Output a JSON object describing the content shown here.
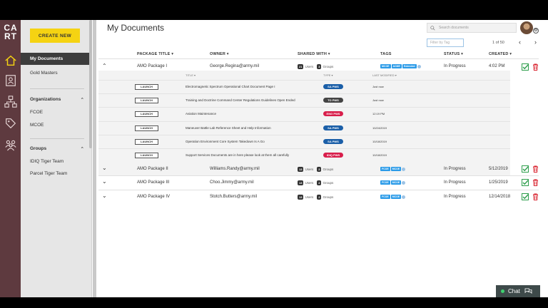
{
  "app": {
    "logo_line1": "CA",
    "logo_line2": "RT"
  },
  "sidebar": {
    "create_label": "CREATE NEW",
    "my_documents": "My Documents",
    "gold_masters": "Gold Masters",
    "organizations_header": "Organizations",
    "organizations": [
      "FCOE",
      "MCOE"
    ],
    "groups_header": "Groups",
    "groups": [
      "IDIQ Tiger Team",
      "Parcel Tiger Team"
    ]
  },
  "main": {
    "title": "My Documents",
    "search_placeholder": "Search documents",
    "filter_placeholder": "Filter by Tag",
    "pager": "1 of 50",
    "columns": {
      "package": "PACKAGE TITLE ▾",
      "owner": "OWNER ▾",
      "shared": "SHARED WITH ▾",
      "tags": "TAGS",
      "status": "STATUS ▾",
      "created": "CREATED ▾"
    },
    "sub_columns": {
      "title": "TITLE ▾",
      "type": "TYPE ▾",
      "modified": "LAST MODIFIED ▾"
    },
    "users_label": "Users",
    "groups_label": "Groups",
    "rows": [
      {
        "title": "AMO Package I",
        "owner": "George.Regina@army.mil",
        "users": "21",
        "groups": "3",
        "tags": [
          "MCOE",
          "ACME",
          "Extended"
        ],
        "status": "In Progress",
        "created": "4:02 PM",
        "docs": [
          {
            "launch": "LAUNCH",
            "title": "Electromagnetic Spectrum Operational Chart Document Page I",
            "type": "SA PWS",
            "type_color": "#1b5fa8",
            "modified": "Just now"
          },
          {
            "launch": "LAUNCH",
            "title": "Training and Doctrine Command Center Regulations Guidelines Open Ended",
            "type": "TO PWS",
            "type_color": "#444444",
            "modified": "Just now"
          },
          {
            "launch": "LAUNCH",
            "title": "Aviation Maintenance",
            "type": "ENG PWS",
            "type_color": "#d81e4b",
            "modified": "12:19 PM"
          },
          {
            "launch": "LAUNCH",
            "title": "Maneuver Battle Lab Reference Sheet and Help Information",
            "type": "SA PWS",
            "type_color": "#1b5fa8",
            "modified": "10/24/2019"
          },
          {
            "launch": "LAUNCH",
            "title": "Operation Environment Core System Takedown Is A Go",
            "type": "SA PWS",
            "type_color": "#1b5fa8",
            "modified": "10/18/2019"
          },
          {
            "launch": "LAUNCH",
            "title": "Support Services Documents are in here please look at them all carefully",
            "type": "IDIQ PWS",
            "type_color": "#d81e4b",
            "modified": "10/18/2019"
          }
        ]
      },
      {
        "title": "AMO Package II",
        "owner": "Williams.Randy@army.mil",
        "users": "13",
        "groups": "2",
        "tags": [
          "FCOE",
          "MCOE"
        ],
        "status": "In Progress",
        "created": "5/12/2019"
      },
      {
        "title": "AMO Package III",
        "owner": "Choo.Jimmy@army.mil",
        "users": "13",
        "groups": "2",
        "tags": [
          "FCOE",
          "MCOE"
        ],
        "status": "In Progress",
        "created": "1/25/2019"
      },
      {
        "title": "AMO Package IV",
        "owner": "Stotch.Butters@army.mil",
        "users": "13",
        "groups": "2",
        "tags": [
          "FCOE",
          "MCOE"
        ],
        "status": "In Progress",
        "created": "12/14/2018"
      }
    ]
  },
  "chat": {
    "label": "Chat"
  },
  "colors": {
    "accent_yellow": "#f5d312",
    "rail": "#5e3a3f",
    "tag_blue": "#2b9be8",
    "check_green": "#2e9e4c",
    "trash_red": "#d81e2a"
  }
}
